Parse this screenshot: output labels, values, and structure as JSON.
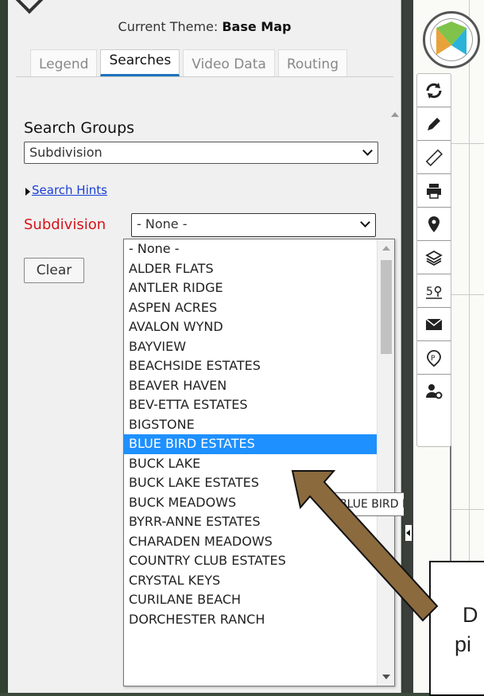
{
  "panel": {
    "theme_prefix": "Current Theme: ",
    "theme_name": "Base Map",
    "tabs": [
      "Legend",
      "Searches",
      "Video Data",
      "Routing"
    ],
    "active_tab": "Searches",
    "search_groups_label": "Search Groups",
    "search_groups_value": "Subdivision",
    "search_hints_link": "Search Hints",
    "subdivision_label": "Subdivision",
    "subdivision_value": "- None -",
    "clear_label": "Clear"
  },
  "dropdown": {
    "options": [
      "- None -",
      "ALDER FLATS",
      "ANTLER RIDGE",
      "ASPEN ACRES",
      "AVALON WYND",
      "BAYVIEW",
      "BEACHSIDE ESTATES",
      "BEAVER HAVEN",
      "BEV-ETTA ESTATES",
      "BIGSTONE",
      "BLUE BIRD ESTATES",
      "BUCK LAKE",
      "BUCK LAKE ESTATES",
      "BUCK MEADOWS",
      "BYRR-ANNE ESTATES",
      "CHARADEN MEADOWS",
      "COUNTRY CLUB ESTATES",
      "CRYSTAL KEYS",
      "CURILANE BEACH",
      "DORCHESTER RANCH"
    ],
    "highlighted": "BLUE BIRD ESTATES"
  },
  "tooltip": {
    "text": "BLUE BIRD ESTATES"
  },
  "callout": {
    "line1": "D",
    "line2": "pi"
  },
  "toolbar": {
    "tools": [
      "refresh-icon",
      "pencil-icon",
      "ruler-icon",
      "printer-icon",
      "map-pin-icon",
      "layers-icon",
      "location-number-icon",
      "envelope-icon",
      "parcel-icon",
      "user-settings-icon"
    ]
  },
  "colors": {
    "highlight": "#1e90ff",
    "subdivision_label": "#d4141a",
    "link": "#1a3fd6",
    "tab_underline": "#1e73be",
    "arrow": "#8b6a3e"
  }
}
